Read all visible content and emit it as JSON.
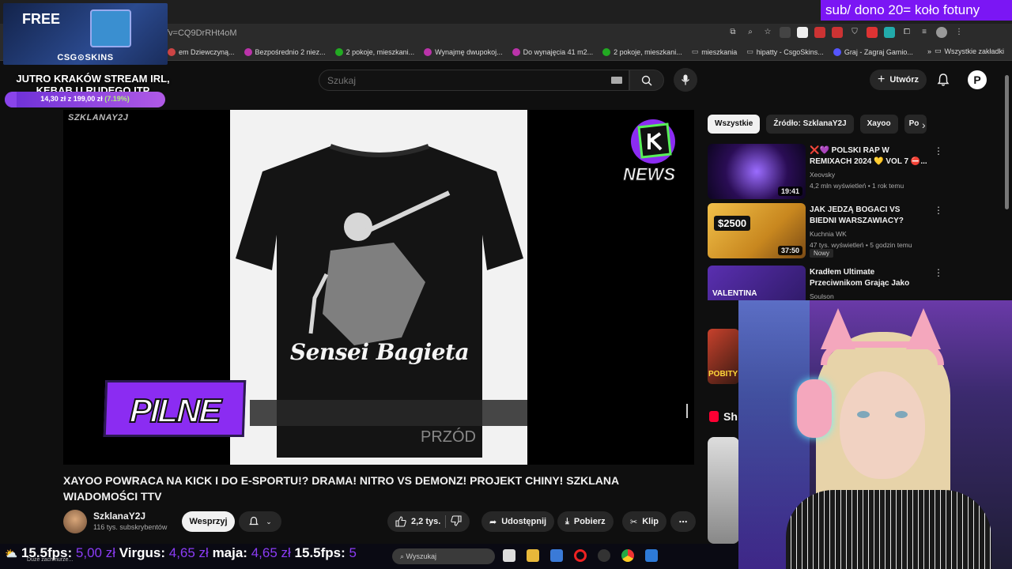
{
  "browser": {
    "url": "/v=CQ9DrRHt4oM",
    "bookmarks": [
      {
        "label": "em Dziewczyną...",
        "color": "#c44"
      },
      {
        "label": "Bezpośrednio 2 niez...",
        "color": "#b3a"
      },
      {
        "label": "2 pokoje, mieszkani...",
        "color": "#2a2"
      },
      {
        "label": "Wynajmę dwupokoj...",
        "color": "#b3a"
      },
      {
        "label": "Do wynajęcia 41 m2...",
        "color": "#b3a"
      },
      {
        "label": "2 pokoje, mieszkani...",
        "color": "#2a2"
      },
      {
        "label": "mieszkania",
        "color": "#888"
      },
      {
        "label": "hipatty - CsgoSkins...",
        "color": "#888"
      },
      {
        "label": "Graj - Zagraj Gamio...",
        "color": "#55f"
      }
    ],
    "all_bookmarks": "Wszystkie zakładki"
  },
  "overlay": {
    "ad_free": "FREE",
    "ad_brand": "CSG⊙SKINS",
    "stream_title": "JUTRO KRAKÓW STREAM IRL, KEBAB U RUDEGO ITP",
    "goal_text": "14,30 zł z 199,00 zł",
    "goal_pct": "(7.19%)",
    "goal_fraction": 0.0719,
    "top_banner": "sub/ dono 20= koło fotuny",
    "donations": [
      {
        "name": "15.5fps:",
        "amount": "5,00 zł"
      },
      {
        "name": "Virgus:",
        "amount": "4,65 zł"
      },
      {
        "name": "maja:",
        "amount": "4,65 zł"
      },
      {
        "name": "15.5fps:",
        "amount": "5"
      }
    ],
    "weather": "Duże zachmurze..."
  },
  "youtube": {
    "search_placeholder": "Szukaj",
    "create_label": "Utwórz",
    "avatar_letter": "P",
    "player": {
      "watermark": "SZKLANAY2J",
      "shirt_text": "Sensei Bagieta",
      "pilne": "PILNE",
      "news": "NEWS",
      "caption": "PRZÓD"
    },
    "video_title": "XAYOO POWRACA NA KICK I DO E-SPORTU!? DRAMA! NITRO VS DEMONZ! PROJEKT CHINY! SZKLANA WIADOMOŚCI TTV",
    "channel": {
      "name": "SzklanaY2J",
      "subs": "116 tys. subskrybentów"
    },
    "support_label": "Wesprzyj",
    "likes": "2,2 tys.",
    "share_label": "Udostępnij",
    "download_label": "Pobierz",
    "clip_label": "Klip",
    "chips": [
      "Wszystkie",
      "Źródło: SzklanaY2J",
      "Xayoo",
      "Po"
    ],
    "recommendations": [
      {
        "title": "❌💜 POLSKI RAP W REMIXACH 2024 💛 VOL 7 ⛔...",
        "channel": "Xeovsky",
        "meta": "4,2 mln wyświetleń • 1 rok temu",
        "duration": "19:41",
        "badge": ""
      },
      {
        "title": "JAK JEDZĄ BOGACI VS BIEDNI WARSZAWIACY?",
        "channel": "Kuchnia WK",
        "meta": "47 tys. wyświetleń • 5 godzin temu",
        "duration": "37:50",
        "badge": "Nowy"
      },
      {
        "title": "Kradłem Ultimate Przeciwnikom Grając Jako Valentina!",
        "channel": "Soulson",
        "meta": "",
        "duration": "",
        "badge": ""
      }
    ],
    "thumb_text_2": "$2500",
    "thumb_text_3": "VALENTINA",
    "thumb_text_4": "POBITY",
    "shorts_label": "Sh"
  },
  "taskbar": {
    "search_label": "Wyszukaj"
  }
}
